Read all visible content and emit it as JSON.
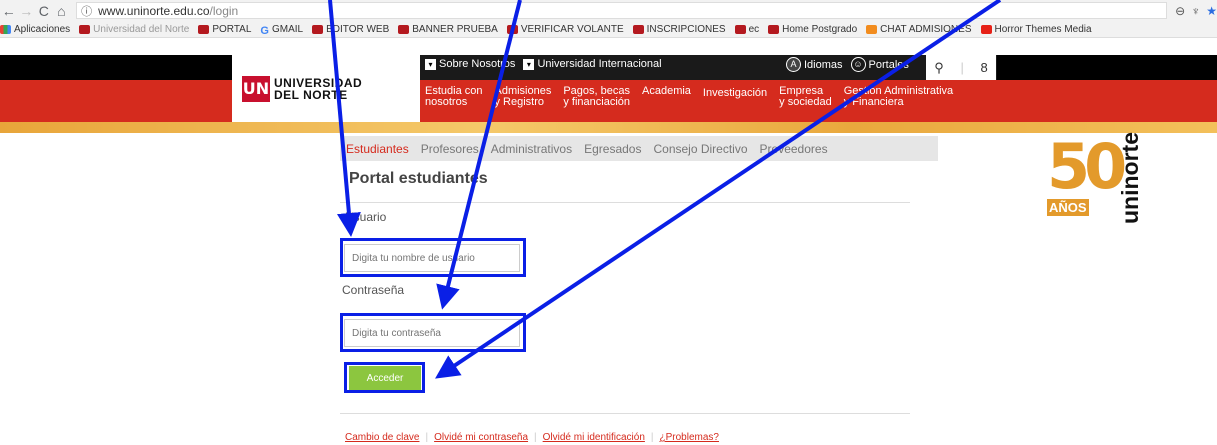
{
  "browser": {
    "url_host": "www.uninorte.edu.co",
    "url_path": "/login",
    "back_icon": "arrow-left",
    "forward_icon": "arrow-right",
    "reload_icon": "reload",
    "home_icon": "home",
    "info_icon": "info-circle"
  },
  "bookmarks": [
    {
      "label": "Aplicaciones",
      "icon": "apps"
    },
    {
      "label": "Universidad del Norte",
      "icon": "uninorte"
    },
    {
      "label": "PORTAL",
      "icon": "uninorte"
    },
    {
      "label": "GMAIL",
      "icon": "google"
    },
    {
      "label": "EDITOR WEB",
      "icon": "uninorte"
    },
    {
      "label": "BANNER PRUEBA",
      "icon": "uninorte"
    },
    {
      "label": "VERIFICAR VOLANTE",
      "icon": "uninorte"
    },
    {
      "label": "INSCRIPCIONES",
      "icon": "uninorte"
    },
    {
      "label": "ec",
      "icon": "uninorte"
    },
    {
      "label": "Home Postgrado",
      "icon": "uninorte"
    },
    {
      "label": "CHAT ADMISIONES",
      "icon": "chat"
    },
    {
      "label": "Horror Themes Media",
      "icon": "youtube"
    }
  ],
  "site": {
    "logo_top": "UNIVERSIDAD",
    "logo_bottom": "DEL NORTE",
    "logo_mark": "UN",
    "util": {
      "sobre": "Sobre Nosotros",
      "internacional": "Universidad Internacional",
      "idiomas": "Idiomas",
      "portales": "Portales"
    },
    "main_nav": [
      {
        "l1": "Estudia con",
        "l2": "nosotros"
      },
      {
        "l1": "Admisiones",
        "l2": "y Registro"
      },
      {
        "l1": "Pagos, becas",
        "l2": "y financiación"
      },
      {
        "l1": "Academia",
        "l2": ""
      },
      {
        "l1": "Investigación",
        "l2": ""
      },
      {
        "l1": "Empresa",
        "l2": "y sociedad"
      },
      {
        "l1": "Gestión Administrativa",
        "l2": "y Financiera"
      }
    ],
    "anniversary": {
      "number": "50",
      "anos": "AÑOS",
      "brand": "uninorte"
    }
  },
  "tabs": [
    "Estudiantes",
    "Profesores",
    "Administrativos",
    "Egresados",
    "Consejo Directivo",
    "Proveedores"
  ],
  "active_tab": "Estudiantes",
  "login": {
    "title": "Portal estudiantes",
    "user_label": "Usuario",
    "user_placeholder": "Digita tu nombre de usuario",
    "pass_label": "Contraseña",
    "pass_placeholder": "Digita tu contraseña",
    "submit": "Acceder"
  },
  "footer_links": [
    "Cambio de clave",
    "Olvidé mi contraseña",
    "Olvidé mi identificación",
    "¿Problemas?"
  ],
  "colors": {
    "brand_red": "#d52b1e",
    "submit_green": "#8cc63f",
    "annotation_blue": "#0a1fe6",
    "gold": "#e39a2b"
  }
}
